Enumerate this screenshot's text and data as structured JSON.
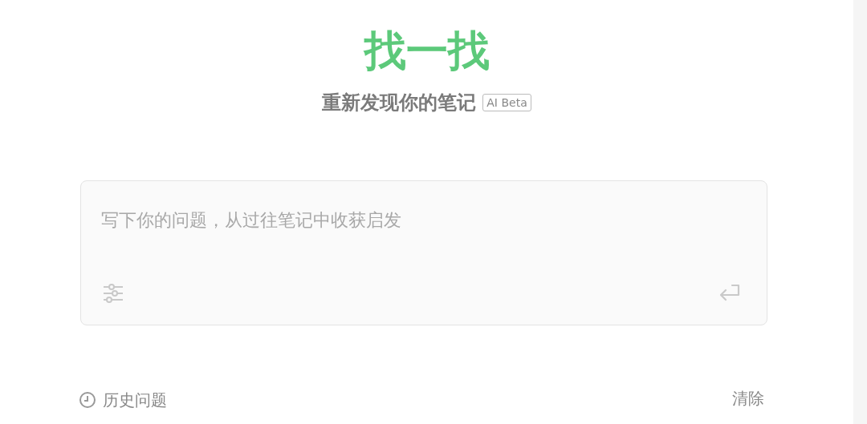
{
  "title": "找一找",
  "subtitle": "重新发现你的笔记",
  "badge": "AI Beta",
  "question_field": {
    "placeholder": "写下你的问题，从过往笔记中收获启发"
  },
  "history": {
    "label": "历史问题"
  },
  "clear_button": "清除"
}
